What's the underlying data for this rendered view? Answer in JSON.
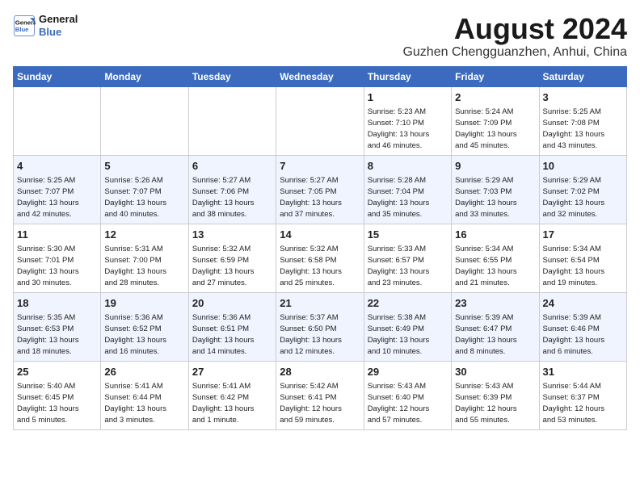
{
  "header": {
    "logo_line1": "General",
    "logo_line2": "Blue",
    "month_year": "August 2024",
    "location": "Guzhen Chengguanzhen, Anhui, China"
  },
  "weekdays": [
    "Sunday",
    "Monday",
    "Tuesday",
    "Wednesday",
    "Thursday",
    "Friday",
    "Saturday"
  ],
  "weeks": [
    [
      {
        "day": "",
        "text": ""
      },
      {
        "day": "",
        "text": ""
      },
      {
        "day": "",
        "text": ""
      },
      {
        "day": "",
        "text": ""
      },
      {
        "day": "1",
        "text": "Sunrise: 5:23 AM\nSunset: 7:10 PM\nDaylight: 13 hours\nand 46 minutes."
      },
      {
        "day": "2",
        "text": "Sunrise: 5:24 AM\nSunset: 7:09 PM\nDaylight: 13 hours\nand 45 minutes."
      },
      {
        "day": "3",
        "text": "Sunrise: 5:25 AM\nSunset: 7:08 PM\nDaylight: 13 hours\nand 43 minutes."
      }
    ],
    [
      {
        "day": "4",
        "text": "Sunrise: 5:25 AM\nSunset: 7:07 PM\nDaylight: 13 hours\nand 42 minutes."
      },
      {
        "day": "5",
        "text": "Sunrise: 5:26 AM\nSunset: 7:07 PM\nDaylight: 13 hours\nand 40 minutes."
      },
      {
        "day": "6",
        "text": "Sunrise: 5:27 AM\nSunset: 7:06 PM\nDaylight: 13 hours\nand 38 minutes."
      },
      {
        "day": "7",
        "text": "Sunrise: 5:27 AM\nSunset: 7:05 PM\nDaylight: 13 hours\nand 37 minutes."
      },
      {
        "day": "8",
        "text": "Sunrise: 5:28 AM\nSunset: 7:04 PM\nDaylight: 13 hours\nand 35 minutes."
      },
      {
        "day": "9",
        "text": "Sunrise: 5:29 AM\nSunset: 7:03 PM\nDaylight: 13 hours\nand 33 minutes."
      },
      {
        "day": "10",
        "text": "Sunrise: 5:29 AM\nSunset: 7:02 PM\nDaylight: 13 hours\nand 32 minutes."
      }
    ],
    [
      {
        "day": "11",
        "text": "Sunrise: 5:30 AM\nSunset: 7:01 PM\nDaylight: 13 hours\nand 30 minutes."
      },
      {
        "day": "12",
        "text": "Sunrise: 5:31 AM\nSunset: 7:00 PM\nDaylight: 13 hours\nand 28 minutes."
      },
      {
        "day": "13",
        "text": "Sunrise: 5:32 AM\nSunset: 6:59 PM\nDaylight: 13 hours\nand 27 minutes."
      },
      {
        "day": "14",
        "text": "Sunrise: 5:32 AM\nSunset: 6:58 PM\nDaylight: 13 hours\nand 25 minutes."
      },
      {
        "day": "15",
        "text": "Sunrise: 5:33 AM\nSunset: 6:57 PM\nDaylight: 13 hours\nand 23 minutes."
      },
      {
        "day": "16",
        "text": "Sunrise: 5:34 AM\nSunset: 6:55 PM\nDaylight: 13 hours\nand 21 minutes."
      },
      {
        "day": "17",
        "text": "Sunrise: 5:34 AM\nSunset: 6:54 PM\nDaylight: 13 hours\nand 19 minutes."
      }
    ],
    [
      {
        "day": "18",
        "text": "Sunrise: 5:35 AM\nSunset: 6:53 PM\nDaylight: 13 hours\nand 18 minutes."
      },
      {
        "day": "19",
        "text": "Sunrise: 5:36 AM\nSunset: 6:52 PM\nDaylight: 13 hours\nand 16 minutes."
      },
      {
        "day": "20",
        "text": "Sunrise: 5:36 AM\nSunset: 6:51 PM\nDaylight: 13 hours\nand 14 minutes."
      },
      {
        "day": "21",
        "text": "Sunrise: 5:37 AM\nSunset: 6:50 PM\nDaylight: 13 hours\nand 12 minutes."
      },
      {
        "day": "22",
        "text": "Sunrise: 5:38 AM\nSunset: 6:49 PM\nDaylight: 13 hours\nand 10 minutes."
      },
      {
        "day": "23",
        "text": "Sunrise: 5:39 AM\nSunset: 6:47 PM\nDaylight: 13 hours\nand 8 minutes."
      },
      {
        "day": "24",
        "text": "Sunrise: 5:39 AM\nSunset: 6:46 PM\nDaylight: 13 hours\nand 6 minutes."
      }
    ],
    [
      {
        "day": "25",
        "text": "Sunrise: 5:40 AM\nSunset: 6:45 PM\nDaylight: 13 hours\nand 5 minutes."
      },
      {
        "day": "26",
        "text": "Sunrise: 5:41 AM\nSunset: 6:44 PM\nDaylight: 13 hours\nand 3 minutes."
      },
      {
        "day": "27",
        "text": "Sunrise: 5:41 AM\nSunset: 6:42 PM\nDaylight: 13 hours\nand 1 minute."
      },
      {
        "day": "28",
        "text": "Sunrise: 5:42 AM\nSunset: 6:41 PM\nDaylight: 12 hours\nand 59 minutes."
      },
      {
        "day": "29",
        "text": "Sunrise: 5:43 AM\nSunset: 6:40 PM\nDaylight: 12 hours\nand 57 minutes."
      },
      {
        "day": "30",
        "text": "Sunrise: 5:43 AM\nSunset: 6:39 PM\nDaylight: 12 hours\nand 55 minutes."
      },
      {
        "day": "31",
        "text": "Sunrise: 5:44 AM\nSunset: 6:37 PM\nDaylight: 12 hours\nand 53 minutes."
      }
    ]
  ]
}
